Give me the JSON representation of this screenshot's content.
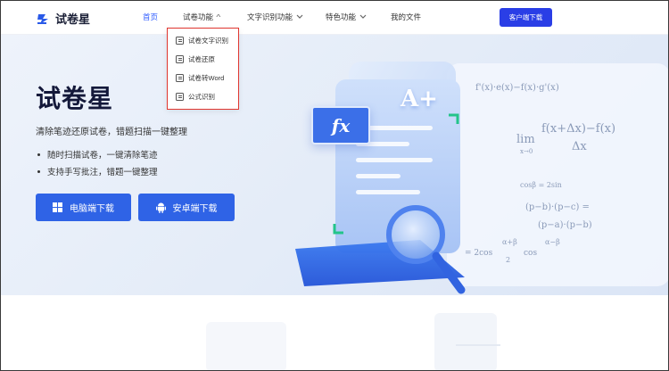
{
  "header": {
    "logo_text": "试卷星",
    "nav": [
      {
        "label": "首页",
        "active": true
      },
      {
        "label": "试卷功能",
        "active": false
      },
      {
        "label": "文字识别功能",
        "active": false
      },
      {
        "label": "特色功能",
        "active": false
      },
      {
        "label": "我的文件",
        "active": false
      }
    ],
    "download_button": "客户端下载"
  },
  "dropdown": {
    "items": [
      {
        "label": "试卷文字识别",
        "icon": "document-text-icon"
      },
      {
        "label": "试卷还原",
        "icon": "document-restore-icon"
      },
      {
        "label": "试卷转Word",
        "icon": "word-convert-icon"
      },
      {
        "label": "公式识别",
        "icon": "formula-icon"
      }
    ]
  },
  "hero": {
    "title": "试卷星",
    "subtitle": "清除笔迹还原试卷，错题扫描一键整理",
    "bullets": [
      "随时扫描试卷，一键清除笔迹",
      "支持手写批注，错题一键整理"
    ],
    "buttons": [
      {
        "label": "电脑端下载",
        "icon": "windows-icon"
      },
      {
        "label": "安卓端下载",
        "icon": "android-icon"
      }
    ],
    "illustration": {
      "badge_fx": "fx",
      "badge_grade": "A+",
      "formulas": [
        "f'(x)·e(x)−f(x)·g'(x)",
        "f(x+Δx)−f(x)",
        "lim",
        "Δx",
        "x→0",
        "cosβ = 2sin",
        "(p−b)·(p−c) =",
        "(p−a)·(p−b)",
        "= 2cos",
        "α+β",
        "α−β",
        "2",
        "cos"
      ]
    }
  },
  "colors": {
    "brand": "#2a3ee6",
    "active_nav": "#2e5bff",
    "hero_button": "#2f63e6",
    "dropdown_highlight": "#e0362f"
  }
}
